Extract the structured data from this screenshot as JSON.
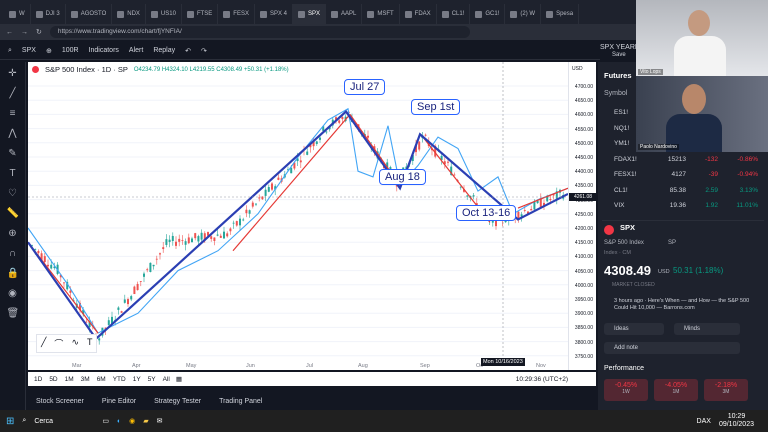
{
  "tabs": [
    {
      "label": "W"
    },
    {
      "label": "DJI 3"
    },
    {
      "label": "AGOSTO"
    },
    {
      "label": "NDX"
    },
    {
      "label": "US10"
    },
    {
      "label": "FTSE"
    },
    {
      "label": "FESX"
    },
    {
      "label": "SPX 4"
    },
    {
      "label": "SPX"
    },
    {
      "label": "AAPL"
    },
    {
      "label": "MSFT"
    },
    {
      "label": "FDAX"
    },
    {
      "label": "CL1!"
    },
    {
      "label": "GC1!"
    },
    {
      "label": "(2) W"
    },
    {
      "label": "Spesa"
    }
  ],
  "address": {
    "url": "https://www.tradingview.com/chart/fjYNFIA/"
  },
  "toolbar": {
    "symbol": "SPX",
    "interval": "100R",
    "indicators": "Indicators",
    "alert": "Alert",
    "replay": "Replay",
    "layout": "SPX YEARLY",
    "save": "Save"
  },
  "chart": {
    "title": "S&P 500 Index · 1D · SP",
    "ohlc": "O4234.79 H4324.10 L4219.55 C4308.49 +50.31 (+1.18%)",
    "currency": "USD",
    "last_price": "4261.08",
    "crosshair_date": "Mon 10/16/2023",
    "annotations": [
      {
        "text": "Jul 27"
      },
      {
        "text": "Sep 1st"
      },
      {
        "text": "Aug 18"
      },
      {
        "text": "Oct 13-16"
      }
    ],
    "price_ticks": [
      "4700.00",
      "4650.00",
      "4600.00",
      "4550.00",
      "4500.00",
      "4450.00",
      "4400.00",
      "4350.00",
      "4300.00",
      "4250.00",
      "4200.00",
      "4150.00",
      "4100.00",
      "4050.00",
      "4000.00",
      "3950.00",
      "3900.00",
      "3850.00",
      "3800.00",
      "3750.00"
    ],
    "time_ticks": [
      "Mar",
      "Apr",
      "May",
      "Jun",
      "Jul",
      "Aug",
      "Sep",
      "Oc",
      "Nov"
    ]
  },
  "timebar": {
    "ranges": [
      "1D",
      "5D",
      "1M",
      "3M",
      "6M",
      "YTD",
      "1Y",
      "5Y",
      "All"
    ],
    "clock": "10:29:36 (UTC+2)"
  },
  "bottom_tabs": [
    "Stock Screener",
    "Pine Editor",
    "Strategy Tester",
    "Trading Panel"
  ],
  "watchlist": {
    "header": "Futures",
    "column": "Symbol",
    "rows": [
      {
        "sym": "ES1!",
        "price": "",
        "chg": "",
        "pct": ""
      },
      {
        "sym": "NQ1!",
        "price": "",
        "chg": "",
        "pct": ""
      },
      {
        "sym": "YM1!",
        "price": "",
        "chg": "",
        "pct": ""
      },
      {
        "sym": "FDAX1!",
        "price": "15213",
        "chg": "-132",
        "pct": "-0.86%"
      },
      {
        "sym": "FESX1!",
        "price": "4127",
        "chg": "-39",
        "pct": "-0.94%"
      },
      {
        "sym": "CL1!",
        "price": "85.38",
        "chg": "2.59",
        "pct": "3.13%"
      },
      {
        "sym": "VIX",
        "price": "19.36",
        "chg": "1.92",
        "pct": "11.01%"
      }
    ]
  },
  "details": {
    "symbol": "SPX",
    "name": "S&P 500 Index",
    "exchange": "SP",
    "type": "Index · CM",
    "price": "4308.49",
    "currency": "USD",
    "change": "50.31 (1.18%)",
    "status": "MARKET CLOSED",
    "news": "3 hours ago · Here's When — and How — the S&P 500 Could Hit 10,000 — Barrons.com",
    "ideas": "Ideas",
    "minds": "Minds",
    "add_note": "Add note",
    "performance": "Performance",
    "perf": [
      {
        "v": "-0.45%",
        "l": "1W"
      },
      {
        "v": "-4.05%",
        "l": "1M"
      },
      {
        "v": "-2.18%",
        "l": "3M"
      }
    ]
  },
  "video": {
    "top_label": "Vito Lops",
    "bottom_label": "Paolo Nardovino"
  },
  "taskbar": {
    "search": "Cerca",
    "ticker": "DAX",
    "time": "10:29",
    "date": "09/10/2023"
  }
}
